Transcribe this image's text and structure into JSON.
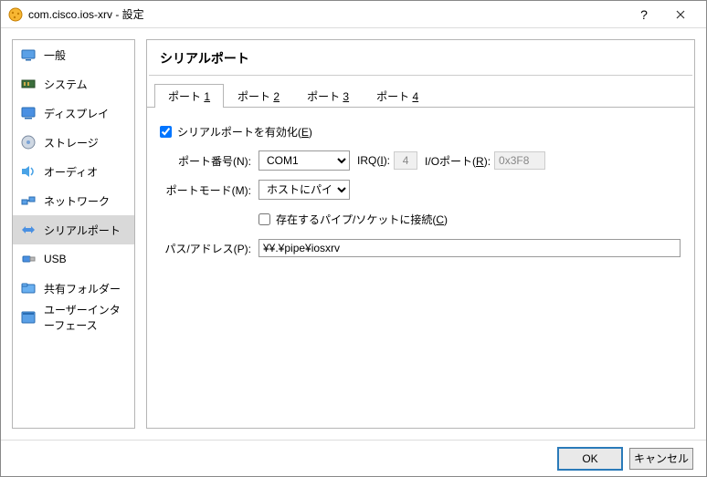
{
  "window": {
    "title": "com.cisco.ios-xrv - 設定"
  },
  "sidebar": {
    "items": [
      {
        "label": "一般",
        "icon": "general"
      },
      {
        "label": "システム",
        "icon": "system"
      },
      {
        "label": "ディスプレイ",
        "icon": "display"
      },
      {
        "label": "ストレージ",
        "icon": "storage"
      },
      {
        "label": "オーディオ",
        "icon": "audio"
      },
      {
        "label": "ネットワーク",
        "icon": "network"
      },
      {
        "label": "シリアルポート",
        "icon": "serial",
        "selected": true
      },
      {
        "label": "USB",
        "icon": "usb"
      },
      {
        "label": "共有フォルダー",
        "icon": "sharedfolder"
      },
      {
        "label": "ユーザーインターフェース",
        "icon": "ui"
      }
    ]
  },
  "main": {
    "header": "シリアルポート",
    "tabs": [
      {
        "prefix": "ポート ",
        "num": "1",
        "active": true
      },
      {
        "prefix": "ポート ",
        "num": "2"
      },
      {
        "prefix": "ポート ",
        "num": "3"
      },
      {
        "prefix": "ポート ",
        "num": "4"
      }
    ],
    "enable_label_pre": "シリアルポートを有効化(",
    "enable_label_u": "E",
    "enable_label_post": ")",
    "enable_checked": true,
    "port_num_label": "ポート番号(N):",
    "port_num_value": "COM1",
    "irq_label_pre": "IRQ(",
    "irq_label_u": "I",
    "irq_label_post": "):",
    "irq_value": "4",
    "ioport_label_pre": "I/Oポート(",
    "ioport_label_u": "R",
    "ioport_label_post": "):",
    "ioport_value": "0x3F8",
    "mode_label": "ポートモード(M):",
    "mode_value": "ホストにパイプ",
    "connect_label_pre": "存在するパイプ/ソケットに接続(",
    "connect_label_u": "C",
    "connect_label_post": ")",
    "connect_checked": false,
    "path_label": "パス/アドレス(P):",
    "path_value": "¥¥.¥pipe¥iosxrv"
  },
  "footer": {
    "ok": "OK",
    "cancel": "キャンセル"
  }
}
